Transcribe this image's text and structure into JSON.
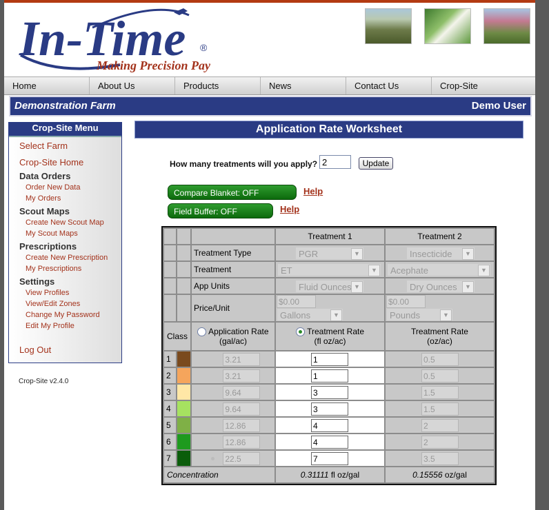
{
  "header": {
    "logo_text": "In-Time",
    "logo_registered": "®",
    "tagline": "Making Precision Pay",
    "brand_color": "#2a3b84",
    "tagline_color": "#a3321b"
  },
  "nav": {
    "items": [
      "Home",
      "About Us",
      "Products",
      "News",
      "Contact Us",
      "Crop-Site"
    ]
  },
  "farm_bar": {
    "farm_name": "Demonstration Farm",
    "user_name": "Demo User"
  },
  "sidebar": {
    "title": "Crop-Site Menu",
    "select_farm": "Select Farm",
    "crop_site_home": "Crop-Site Home",
    "data_orders": "Data Orders",
    "order_new_data": "Order New Data",
    "my_orders": "My Orders",
    "scout_maps": "Scout Maps",
    "create_new_scout_map": "Create New Scout Map",
    "my_scout_maps": "My Scout Maps",
    "prescriptions": "Prescriptions",
    "create_new_prescription": "Create New Prescription",
    "my_prescriptions": "My Prescriptions",
    "settings": "Settings",
    "view_profiles": "View Profiles",
    "view_edit_zones": "View/Edit Zones",
    "change_my_password": "Change My Password",
    "edit_my_profile": "Edit My Profile",
    "log_out": "Log Out"
  },
  "version": "Crop-Site v2.4.0",
  "worksheet": {
    "title": "Application Rate Worksheet",
    "question": "How many treatments will you apply?",
    "treatments_value": "2",
    "update_label": "Update",
    "compare_blanket": "Compare Blanket: OFF",
    "field_buffer": "Field Buffer: OFF",
    "help_label": "Help"
  },
  "table": {
    "treatment1_header": "Treatment 1",
    "treatment2_header": "Treatment 2",
    "row_labels": {
      "treatment_type": "Treatment Type",
      "treatment": "Treatment",
      "app_units": "App Units",
      "price_unit": "Price/Unit"
    },
    "t1": {
      "type": "PGR",
      "treatment": "ET",
      "app_units": "Fluid Ounces",
      "price": "$0.00",
      "price_unit": "Gallons"
    },
    "t2": {
      "type": "Insecticide",
      "treatment": "Acephate",
      "app_units": "Dry Ounces",
      "price": "$0.00",
      "price_unit": "Pounds"
    },
    "class_header": "Class",
    "app_rate_header": "Application Rate",
    "app_rate_unit": "(gal/ac)",
    "treat_rate_header": "Treatment Rate",
    "treat_rate_unit_t1": "(fl oz/ac)",
    "treat_rate_unit_t2": "(oz/ac)",
    "rows": [
      {
        "cls": "1",
        "color": "#7a4a1e",
        "app_rate": "3.21",
        "t1_rate": "1",
        "t2_rate": "0.5"
      },
      {
        "cls": "2",
        "color": "#f5a55c",
        "app_rate": "3.21",
        "t1_rate": "1",
        "t2_rate": "0.5"
      },
      {
        "cls": "3",
        "color": "#ffe7a6",
        "app_rate": "9.64",
        "t1_rate": "3",
        "t2_rate": "1.5"
      },
      {
        "cls": "4",
        "color": "#a6e260",
        "app_rate": "9.64",
        "t1_rate": "3",
        "t2_rate": "1.5"
      },
      {
        "cls": "5",
        "color": "#7fb046",
        "app_rate": "12.86",
        "t1_rate": "4",
        "t2_rate": "2"
      },
      {
        "cls": "6",
        "color": "#1e9a1e",
        "app_rate": "12.86",
        "t1_rate": "4",
        "t2_rate": "2"
      },
      {
        "cls": "7",
        "color": "#0b5d0b",
        "app_rate": "22.5",
        "t1_rate": "7",
        "t2_rate": "3.5"
      }
    ],
    "concentration_label": "Concentration",
    "t1_concentration_value": "0.31111",
    "t1_concentration_unit": "fl oz/gal",
    "t2_concentration_value": "0.15556",
    "t2_concentration_unit": "oz/gal"
  }
}
